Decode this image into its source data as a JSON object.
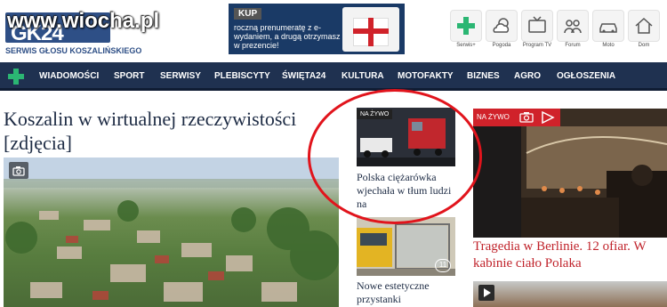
{
  "header": {
    "logo_text": "GK24",
    "logo_sub": "SERWIS GŁOSU KOSZALIŃSKIEGO",
    "watermark": "www.wiocha.pl",
    "promo": {
      "tag": "KUP",
      "text": "roczną prenumeratę z e-wydaniem, a drugą otrzymasz w prezencie!"
    },
    "icons": [
      {
        "label": "Serwis+",
        "icon": "plus-icon"
      },
      {
        "label": "Pogoda",
        "icon": "weather-icon"
      },
      {
        "label": "Program TV",
        "icon": "tv-icon"
      },
      {
        "label": "Forum",
        "icon": "forum-icon"
      },
      {
        "label": "Moto",
        "icon": "car-icon"
      },
      {
        "label": "Dom",
        "icon": "house-icon"
      }
    ]
  },
  "nav": {
    "items": [
      "WIADOMOŚCI",
      "SPORT",
      "SERWISY",
      "PLEBISCYTY",
      "ŚWIĘTA24",
      "KULTURA",
      "MOTOFAKTY",
      "BIZNES",
      "AGRO",
      "OGŁOSZENIA"
    ]
  },
  "main": {
    "headline": "Koszalin w wirtualnej rzeczywistości [zdjęcia]"
  },
  "middle": {
    "story1": {
      "live_tag": "NA ŻYWO",
      "title": "Polska ciężarówka wjechała w tłum ludzi na"
    },
    "story2": {
      "gallery_count": "11",
      "title": "Nowe estetyczne przystanki"
    }
  },
  "right": {
    "live_tag": "NA ŻYWO",
    "title": "Tragedia w Berlinie. 12 ofiar. W kabinie ciało Polaka"
  },
  "colors": {
    "nav_bg": "#1f3150",
    "accent_green": "#2bb673",
    "brand_blue": "#2e4f86",
    "alert_red": "#d0222a",
    "annotation_red": "#e1141c"
  }
}
